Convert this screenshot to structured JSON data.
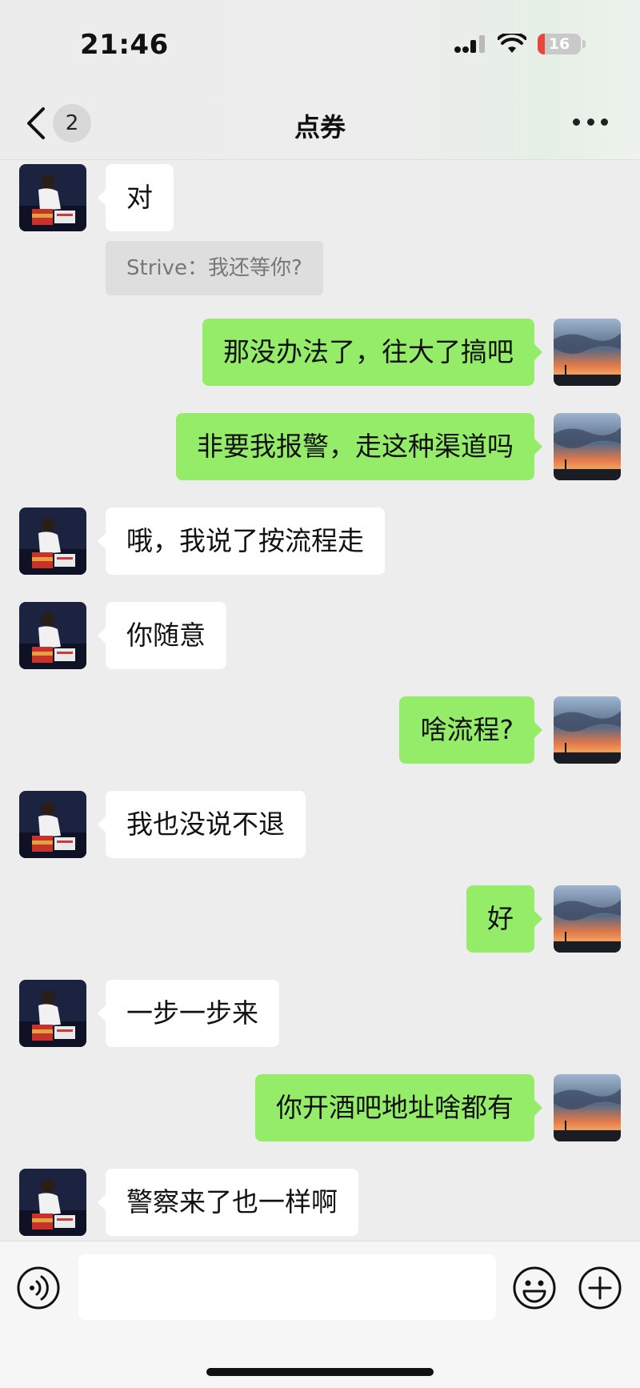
{
  "status_bar": {
    "time": "21:46",
    "battery": "16"
  },
  "header": {
    "back_count": "2",
    "title": "点券"
  },
  "messages": [
    {
      "side": "left",
      "text": "对",
      "top": 0
    },
    {
      "side": "right",
      "text": "那没办法了，往大了搞吧"
    },
    {
      "side": "right",
      "text": "非要我报警，走这种渠道吗"
    },
    {
      "side": "left",
      "text": "哦，我说了按流程走"
    },
    {
      "side": "left",
      "text": "你随意"
    },
    {
      "side": "right",
      "text": "啥流程?"
    },
    {
      "side": "left",
      "text": "我也没说不退"
    },
    {
      "side": "right",
      "text": "好"
    },
    {
      "side": "left",
      "text": "一步一步来"
    },
    {
      "side": "right",
      "text": "你开酒吧地址啥都有"
    },
    {
      "side": "left",
      "text": "警察来了也一样啊"
    }
  ],
  "quote": "Strive：我还等你?",
  "icons": {
    "back": "chevron-left-icon",
    "more": "more-dots-icon",
    "voice": "voice-icon",
    "emoji": "emoji-icon",
    "plus": "plus-icon"
  },
  "colors": {
    "sent_bubble": "#95ec69",
    "received_bubble": "#ffffff",
    "background": "#ededed"
  }
}
